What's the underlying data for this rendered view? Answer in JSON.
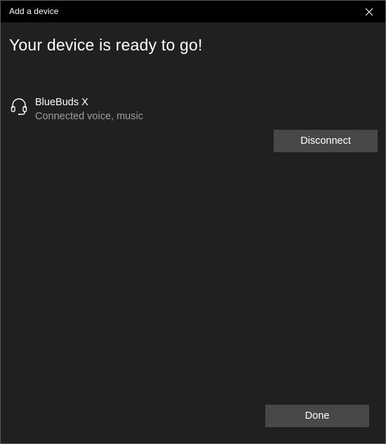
{
  "window": {
    "title": "Add a device",
    "close_icon": "close-icon"
  },
  "main": {
    "heading": "Your device is ready to go!"
  },
  "device": {
    "icon": "headset-icon",
    "name": "BlueBuds X",
    "status": "Connected voice, music",
    "disconnect_label": "Disconnect"
  },
  "footer": {
    "done_label": "Done"
  },
  "colors": {
    "titlebar_bg": "#000000",
    "window_bg": "#202020",
    "button_bg": "#484848",
    "secondary_text": "#9d9d9d"
  }
}
